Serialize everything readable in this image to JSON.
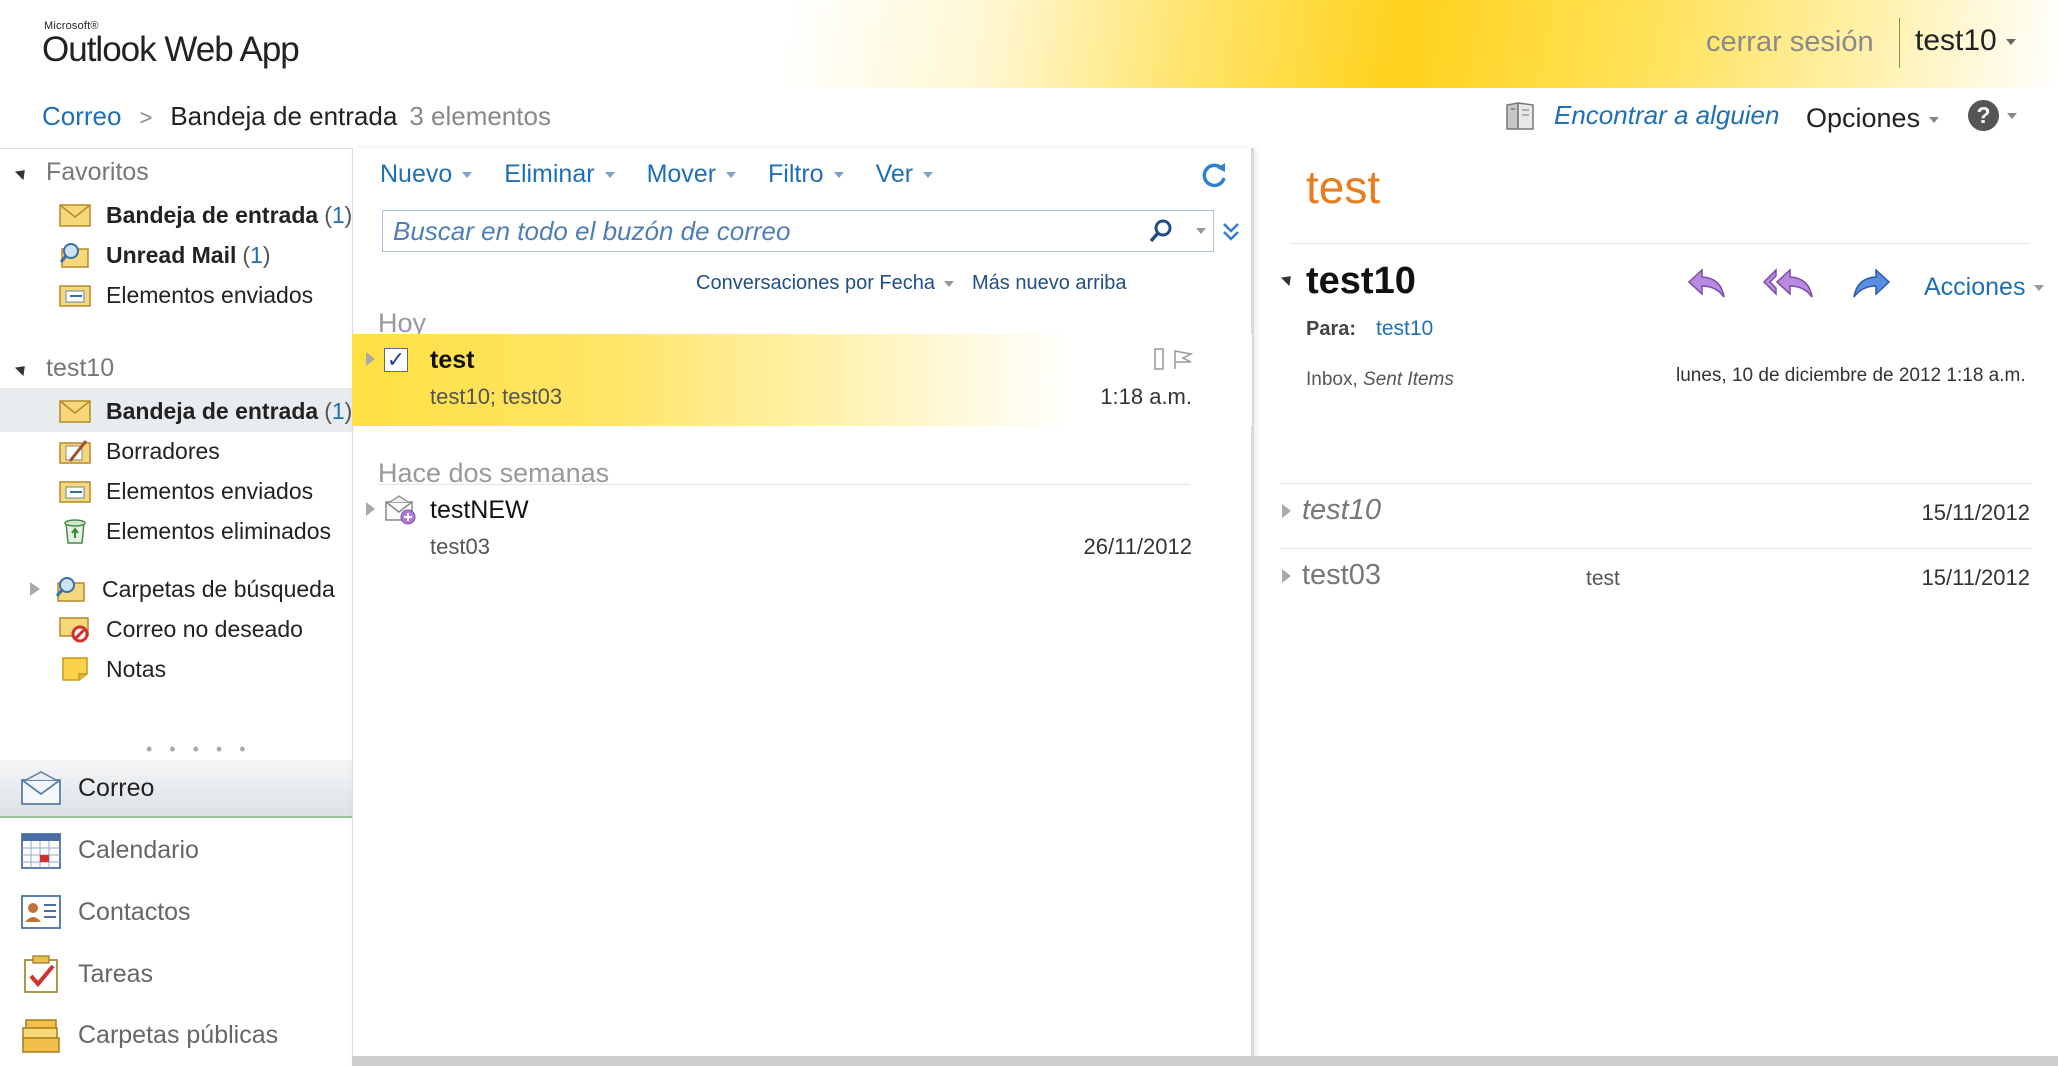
{
  "header": {
    "logo_microsoft": "Microsoft®",
    "logo_name": "Outlook Web App",
    "signout_label": "cerrar sesión",
    "user_name": "test10"
  },
  "breadcrumb": {
    "root": "Correo",
    "separator": ">",
    "folder": "Bandeja de entrada",
    "count": "3 elementos"
  },
  "topbar": {
    "find_someone": "Encontrar a alguien",
    "options": "Opciones",
    "help": "?"
  },
  "nav": {
    "favorites_title": "Favoritos",
    "favorites": [
      {
        "label": "Bandeja de entrada",
        "count": "1",
        "icon": "inbox-icon"
      },
      {
        "label": "Unread Mail",
        "count": "1",
        "icon": "search-folder-icon"
      },
      {
        "label": "Elementos enviados",
        "count": "",
        "icon": "sent-icon"
      }
    ],
    "mailbox_title": "test10",
    "folders": [
      {
        "label": "Bandeja de entrada",
        "count": "1",
        "icon": "inbox-icon",
        "selected": true
      },
      {
        "label": "Borradores",
        "count": "",
        "icon": "drafts-icon"
      },
      {
        "label": "Elementos enviados",
        "count": "",
        "icon": "sent-icon"
      },
      {
        "label": "Elementos eliminados",
        "count": "",
        "icon": "deleted-icon"
      },
      {
        "label": "Carpetas de búsqueda",
        "count": "",
        "icon": "search-folder-icon"
      },
      {
        "label": "Correo no deseado",
        "count": "",
        "icon": "junk-icon"
      },
      {
        "label": "Notas",
        "count": "",
        "icon": "notes-icon"
      }
    ],
    "drag_handle": "• • • • •",
    "modules": [
      {
        "label": "Correo",
        "icon": "mail-icon",
        "active": true
      },
      {
        "label": "Calendario",
        "icon": "calendar-icon"
      },
      {
        "label": "Contactos",
        "icon": "contacts-icon"
      },
      {
        "label": "Tareas",
        "icon": "tasks-icon"
      },
      {
        "label": "Carpetas públicas",
        "icon": "public-folders-icon"
      }
    ]
  },
  "toolbar": {
    "new": "Nuevo",
    "delete": "Eliminar",
    "move": "Mover",
    "filter": "Filtro",
    "view": "Ver"
  },
  "search": {
    "placeholder": "Buscar en todo el buzón de correo"
  },
  "sort": {
    "by": "Conversaciones por Fecha",
    "order": "Más nuevo arriba"
  },
  "groups": [
    {
      "title": "Hoy",
      "messages": [
        {
          "subject": "test",
          "from": "test10; test03",
          "time": "1:18 a.m.",
          "selected": true,
          "checked": "✓"
        }
      ]
    },
    {
      "title": "Hace dos semanas",
      "messages": [
        {
          "subject": "testNEW",
          "from": "test03",
          "time": "26/11/2012"
        }
      ]
    }
  ],
  "reading": {
    "subject": "test",
    "sender": "test10",
    "to_label": "Para:",
    "to_value": "test10",
    "actions": "Acciones",
    "folder": "Inbox,",
    "folder_secondary": "Sent Items",
    "date": "lunes, 10 de diciembre de 2012 1:18 a.m.",
    "thread": [
      {
        "name": "test10",
        "preview": "",
        "date": "15/11/2012"
      },
      {
        "name": "test03",
        "preview": "test",
        "date": "15/11/2012"
      }
    ]
  },
  "colors": {
    "accent_blue": "#1f6fb6",
    "subject_orange": "#e87d1e",
    "highlight_yellow": "#ffe042",
    "reply_purple": "#9b59d0"
  }
}
